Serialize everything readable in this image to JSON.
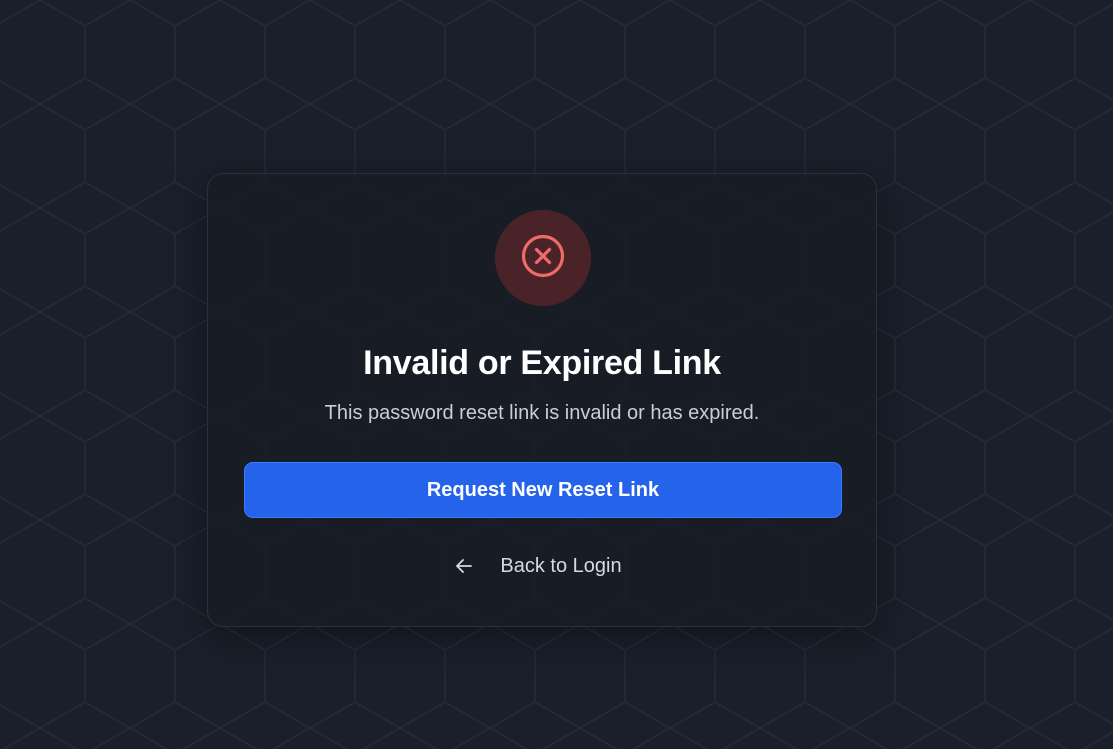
{
  "error_card": {
    "title": "Invalid or Expired Link",
    "message": "This password reset link is invalid or has expired.",
    "primary_button_label": "Request New Reset Link",
    "back_link_label": "Back to Login"
  },
  "icons": {
    "status": "x-circle-icon",
    "back": "arrow-left-icon"
  },
  "colors": {
    "background": "#1a1f2b",
    "error_accent": "#f06a6a",
    "error_bg": "#4a2329",
    "primary": "#2563eb"
  }
}
